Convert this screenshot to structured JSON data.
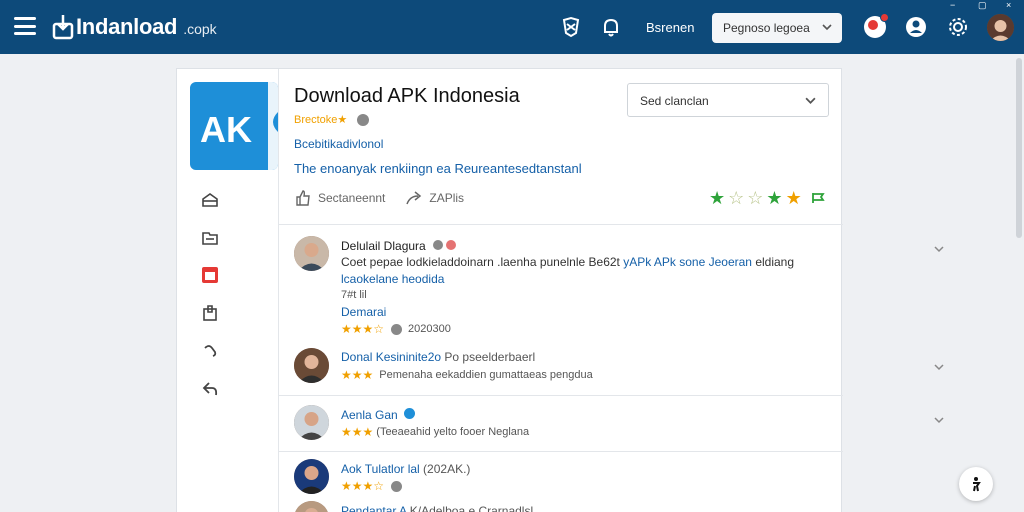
{
  "topbar": {
    "brand": "Indanload",
    "brand_suffix": ".copk",
    "link_label": "Bsrenen",
    "select_value": "Pegnoso legoea",
    "window_controls": [
      "−",
      "▢",
      "×"
    ],
    "icons": [
      "menu-icon",
      "shield-icon",
      "bell-icon",
      "notification-badge-icon",
      "user-icon",
      "settings-icon"
    ]
  },
  "app": {
    "title": "Download APK Indonesia",
    "tile_letters": "AK",
    "rating_label": "Brectoke★",
    "subtitle": "Bcebitikadivlonol",
    "tagline": "The enoanyak renkiingn ea Reureantesedtanstanl",
    "sort_select": "Sed clanclan",
    "actions": [
      {
        "icon": "thumbs-up-icon",
        "label": "Sectaneennt"
      },
      {
        "icon": "share-icon",
        "label": "ZAPlis"
      }
    ],
    "rating_stars": [
      "★",
      "☆",
      "☆",
      "★",
      "★"
    ],
    "rating_star_colors": [
      "#2ea33a",
      "#b8c48a",
      "#b8c48a",
      "#2ea33a",
      "#f0a000"
    ]
  },
  "rail": {
    "icons": [
      "inbox-icon",
      "folder-icon",
      "calendar-icon",
      "clipboard-icon",
      "link-icon",
      "reply-icon"
    ]
  },
  "reviews": [
    {
      "name": "Delulail Dlagura",
      "text": "Coet pepae lodkieladdoinarn .laenha punelnle Be62t",
      "link": "yAPk APk sone Jeoeran",
      "text_end": "eldiang",
      "line2": "lcaokelane heodida",
      "line3": "7#t lil",
      "line4": "Demarai",
      "stars": "★★★☆",
      "date": "2020300"
    },
    {
      "name": "Donal Kesininite2o",
      "name_suffix": "Po pseelderbaerl",
      "text": "Pemenaha eekaddien gumattaeas pengdua",
      "stars": "★★★"
    },
    {
      "name": "Aenla Gan",
      "text": "(Teeaeahid yelto fooer Neglana",
      "stars": "★★★"
    },
    {
      "name": "Aok Tulatlor lal",
      "name_suffix": "(202AK.)",
      "stars": "★★★☆"
    },
    {
      "name": "Pendantar A",
      "text": "K/Adelboa e Crarnadlsl"
    }
  ],
  "colors": {
    "topbar": "#0d4a7a",
    "accent": "#1e8fd8",
    "link": "#1560a8",
    "star": "#f0a000"
  }
}
